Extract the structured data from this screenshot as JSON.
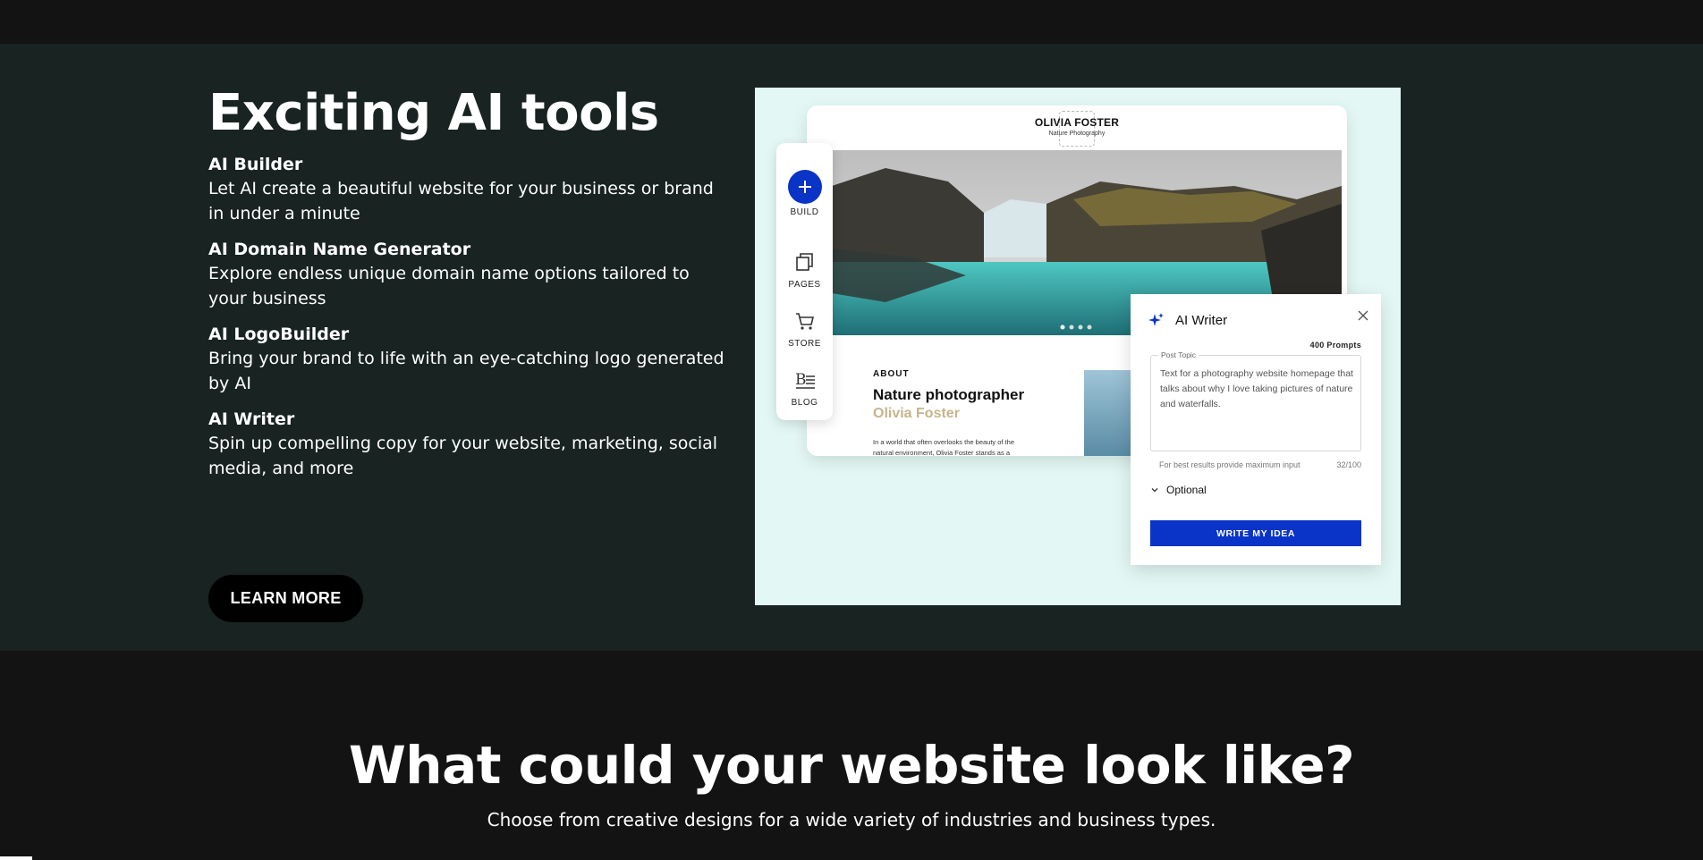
{
  "hero": {
    "title": "Exciting AI tools",
    "features": [
      {
        "name": "AI Builder",
        "desc": "Let AI create a beautiful website for your business or brand in under a minute"
      },
      {
        "name": "AI Domain Name Generator",
        "desc": "Explore endless unique domain name options tailored to your business"
      },
      {
        "name": "AI LogoBuilder",
        "desc": "Bring your brand to life with an eye-catching logo generated by AI"
      },
      {
        "name": "AI Writer",
        "desc": "Spin up compelling copy for your website, marketing, social media, and more"
      }
    ],
    "cta_label": "LEARN MORE"
  },
  "mock": {
    "site": {
      "logo_name": "OLIVIA FOSTER",
      "logo_sub": "Nature Photography",
      "about_label": "ABOUT",
      "about_title": "Nature photographer",
      "about_name": "Olivia Foster",
      "about_body": "In a world that often overlooks the beauty of the natural environment, Olivia Foster stands as a"
    },
    "tools": [
      {
        "label": "BUILD",
        "icon": "plus-icon"
      },
      {
        "label": "PAGES",
        "icon": "pages-icon"
      },
      {
        "label": "STORE",
        "icon": "cart-icon"
      },
      {
        "label": "BLOG",
        "icon": "blog-icon"
      }
    ],
    "writer": {
      "title": "AI Writer",
      "prompts": "400 Prompts",
      "topic_label": "Post Topic",
      "topic_text": "Text for a photography website homepage that talks about why I love taking pictures of nature and waterfalls.",
      "hint": "For best results provide maximum input",
      "count": "32/100",
      "optional_label": "Optional",
      "button_label": "WRITE MY IDEA"
    },
    "accent": "#0a33c7"
  },
  "section2": {
    "title": "What could your website look like?",
    "subtitle": "Choose from creative designs for a wide variety of industries and business types."
  }
}
